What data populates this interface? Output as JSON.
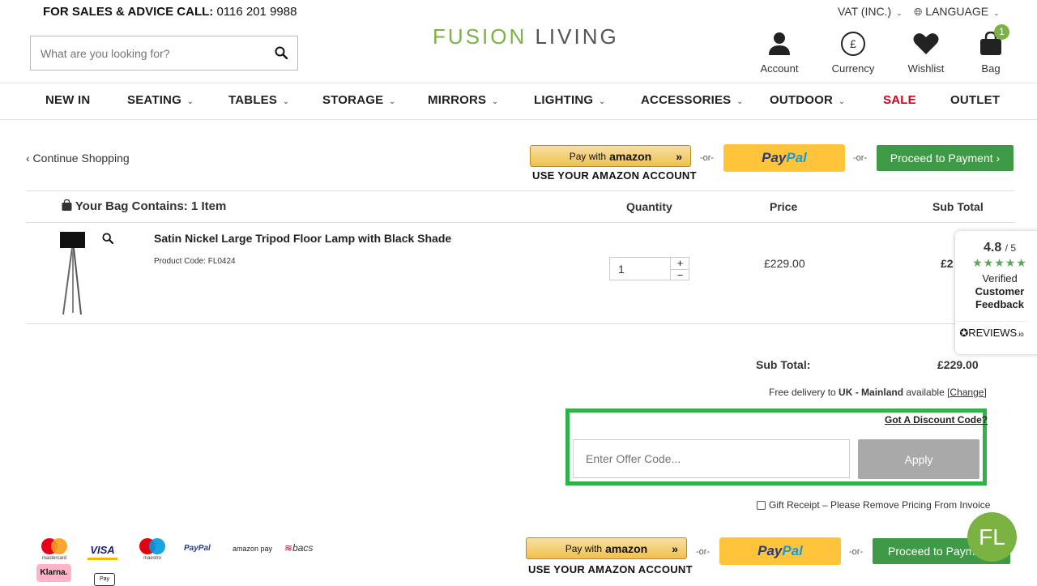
{
  "topbar": {
    "sales_label": "FOR SALES & ADVICE CALL:",
    "sales_phone": "0116 201 9988",
    "vat": "VAT (INC.)",
    "language": "LANGUAGE"
  },
  "search": {
    "placeholder": "What are you looking for?"
  },
  "logo": {
    "part1": "FUSION",
    "part2": "LIVING"
  },
  "header_icons": {
    "account": "Account",
    "currency": "Currency",
    "currency_symbol": "£",
    "wishlist": "Wishlist",
    "bag": "Bag",
    "bag_count": "1"
  },
  "nav": {
    "new_in": "NEW IN",
    "seating": "SEATING",
    "tables": "TABLES",
    "storage": "STORAGE",
    "mirrors": "MIRRORS",
    "lighting": "LIGHTING",
    "accessories": "ACCESSORIES",
    "outdoor": "OUTDOOR",
    "sale": "SALE",
    "outlet": "OUTLET"
  },
  "checkout": {
    "continue": "‹ Continue Shopping",
    "amazon_pay_with": "Pay with",
    "amazon_brand": "amazon",
    "amazon_sub": "USE YOUR AMAZON ACCOUNT",
    "or": "-or-",
    "paypal_1": "Pay",
    "paypal_2": "Pal",
    "proceed": "Proceed to Payment ›",
    "proceed_cut": "Proceed to Payme"
  },
  "bag": {
    "heading": "Your Bag Contains: 1 Item",
    "col_quantity": "Quantity",
    "col_price": "Price",
    "col_subtotal": "Sub Total",
    "item": {
      "name": "Satin Nickel Large Tripod Floor Lamp with Black Shade",
      "code": "Product Code: FL0424",
      "quantity": "1",
      "price": "£229.00",
      "subtotal_visible": "£2"
    }
  },
  "reviews": {
    "score": "4.8",
    "out_of": "/ 5",
    "stars": "★★★★★",
    "verified": "Verified",
    "customer_feedback_1": "Customer",
    "customer_feedback_2": "Feedback",
    "brand": "REVIEWS",
    "brand_suffix": ".io"
  },
  "totals": {
    "subtotal_label": "Sub Total:",
    "subtotal_value": "£229.00",
    "delivery_pre": "Free delivery to ",
    "delivery_region": "UK - Mainland",
    "delivery_post": " available [",
    "change": "Change",
    "close": "]"
  },
  "discount": {
    "link": "Got A Discount Code?",
    "placeholder": "Enter Offer Code...",
    "apply": "Apply"
  },
  "gift": {
    "label": "Gift Receipt – Please Remove Pricing From Invoice"
  },
  "payment_logos": {
    "mastercard": "mastercard",
    "visa": "VISA",
    "maestro": "maestro",
    "paypal": "PayPal",
    "amazonpay": "amazon pay",
    "bacs": "bacs",
    "klarna": "Klarna.",
    "applepay": "Pay"
  },
  "chat": {
    "initials": "FL"
  },
  "colors": {
    "brand_green": "#7bb342",
    "proceed_green": "#3f9a47",
    "sale_red": "#d0021b",
    "highlight_green": "#2db34a"
  }
}
